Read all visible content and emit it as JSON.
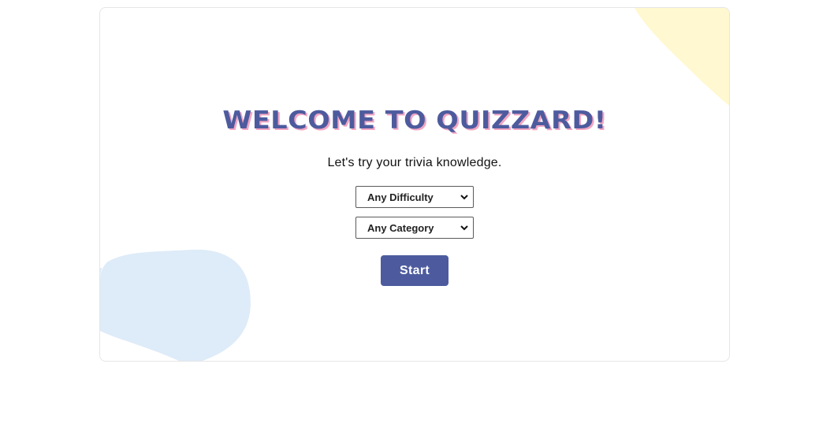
{
  "welcome": {
    "title": "WELCOME TO QUIZZARD!",
    "subtitle": "Let's try your trivia knowledge."
  },
  "filters": {
    "difficulty": {
      "selected": "Any Difficulty",
      "icon": "chevron-down-icon"
    },
    "category": {
      "selected": "Any Category",
      "icon": "chevron-down-icon"
    }
  },
  "actions": {
    "start_label": "Start"
  },
  "colors": {
    "accent": "#4d5b9e",
    "title_shadow": "#f3a6c2",
    "blob_yellow": "#fff8d0",
    "blob_blue": "#deebf8"
  }
}
